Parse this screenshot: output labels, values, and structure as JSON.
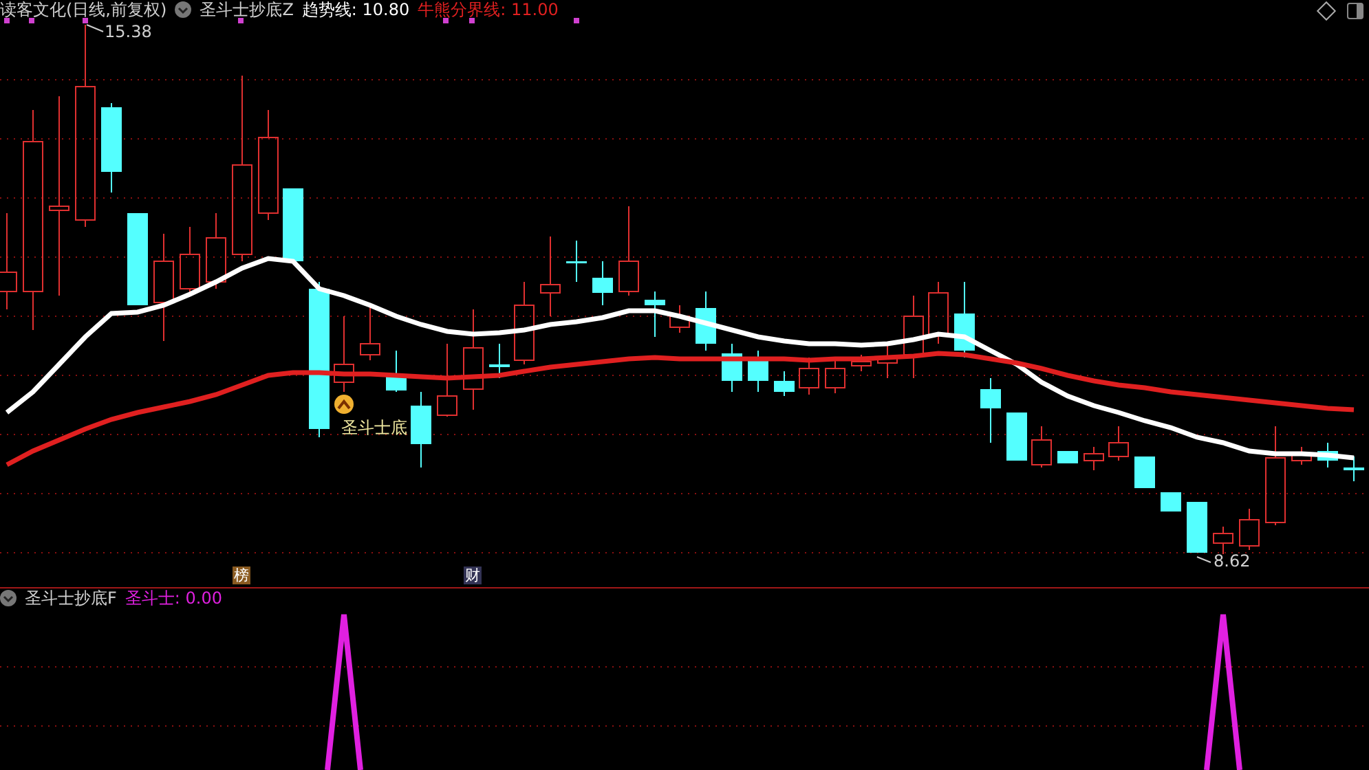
{
  "header": {
    "title": "读客文化(日线,前复权)",
    "indicator": "圣斗士抄底Z",
    "lines": [
      {
        "text": "趋势线: 10.80",
        "color": "#ffffff"
      },
      {
        "text": "牛熊分界线: 11.00",
        "color": "#e02020"
      }
    ]
  },
  "main_chart": {
    "max_label": "15.38",
    "min_label": "8.62",
    "signal_label": "圣斗士底",
    "markers": [
      {
        "text": "榜"
      },
      {
        "text": "财"
      }
    ]
  },
  "sub_panel": {
    "indicator": "圣斗士抄底F",
    "lines": [
      {
        "text": "圣斗士: 0.00",
        "color": "#e020e0"
      }
    ]
  }
}
